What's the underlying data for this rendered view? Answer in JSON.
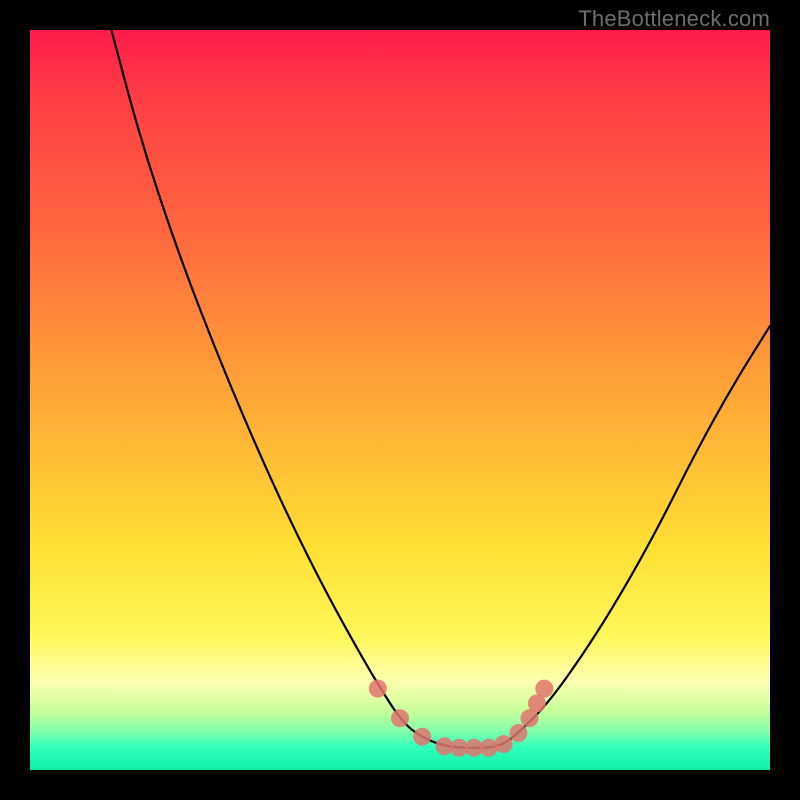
{
  "attribution": "TheBottleneck.com",
  "chart_data": {
    "type": "line",
    "title": "",
    "xlabel": "",
    "ylabel": "",
    "xlim": [
      0,
      100
    ],
    "ylim": [
      0,
      100
    ],
    "series": [
      {
        "name": "bottleneck-curve",
        "x": [
          11,
          15,
          20,
          25,
          30,
          35,
          40,
          45,
          48,
          50,
          52,
          55,
          58,
          60,
          62,
          64,
          66,
          70,
          75,
          80,
          85,
          90,
          95,
          100
        ],
        "y": [
          100,
          85,
          70,
          57,
          45,
          34,
          24,
          15,
          10,
          7,
          5,
          3.5,
          3,
          3,
          3,
          3.5,
          5,
          9,
          16,
          24,
          33,
          43,
          52,
          60
        ]
      }
    ],
    "markers": {
      "name": "highlight-points",
      "color": "#e0746e",
      "points": [
        {
          "x": 47,
          "y": 11
        },
        {
          "x": 50,
          "y": 7
        },
        {
          "x": 53,
          "y": 4.5
        },
        {
          "x": 56,
          "y": 3.2
        },
        {
          "x": 58,
          "y": 3
        },
        {
          "x": 60,
          "y": 3
        },
        {
          "x": 62,
          "y": 3
        },
        {
          "x": 64,
          "y": 3.5
        },
        {
          "x": 66,
          "y": 5
        },
        {
          "x": 67.5,
          "y": 7
        },
        {
          "x": 68.5,
          "y": 9
        },
        {
          "x": 69.5,
          "y": 11
        }
      ]
    }
  }
}
